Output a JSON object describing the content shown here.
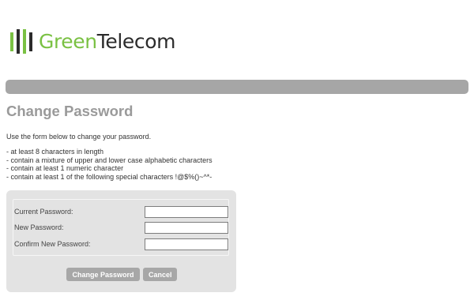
{
  "brand": {
    "name_part1": "Green",
    "name_part2": "Telecom",
    "logo_bar_colors": [
      "#7ac143",
      "#2b2b2b",
      "#7ac143",
      "#2b2b2b"
    ],
    "accent_color": "#7ac143"
  },
  "navbar": {
    "color": "#a6a6a6"
  },
  "page": {
    "title": "Change Password",
    "intro": "Use the form below to change your password.",
    "rules": [
      "- at least 8 characters in length",
      "- contain a mixture of upper and lower case alphabetic characters",
      "- contain at least 1 numeric character",
      "- contain at least 1 of the following special characters !@$%()~^*-"
    ]
  },
  "form": {
    "fields": [
      {
        "label": "Current Password:",
        "value": "",
        "placeholder": ""
      },
      {
        "label": "New Password:",
        "value": "",
        "placeholder": ""
      },
      {
        "label": "Confirm New Password:",
        "value": "",
        "placeholder": ""
      }
    ],
    "buttons": {
      "change_label": "Change Password",
      "cancel_label": "Cancel"
    }
  }
}
